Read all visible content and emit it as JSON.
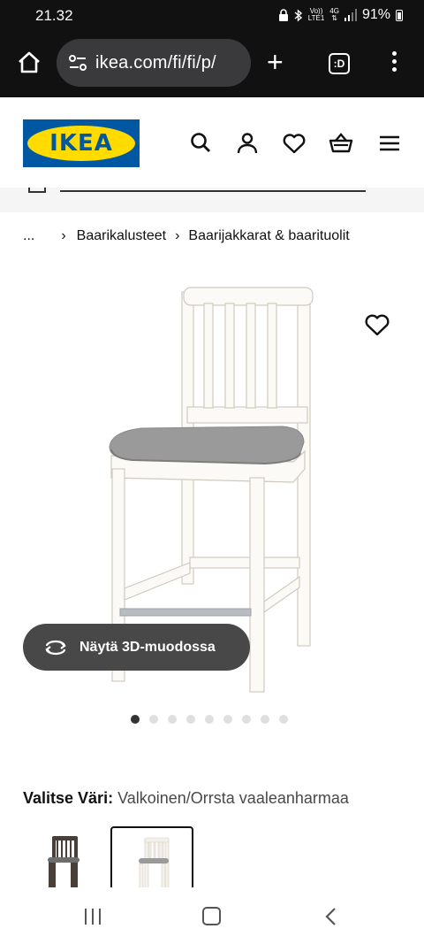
{
  "status_bar": {
    "time": "21.32",
    "network_top": "Vo))",
    "network_bottom": "LTE1",
    "network_type": "4G",
    "battery": "91%"
  },
  "browser": {
    "url": "ikea.com/fi/fi/p/",
    "tab_count": ":D",
    "icons": [
      "home-icon",
      "site-settings-icon",
      "new-tab-icon",
      "tab-switcher-icon",
      "menu-icon"
    ]
  },
  "header": {
    "logo_text": "IKEA",
    "icons": [
      "search-icon",
      "account-icon",
      "favourites-icon",
      "shopping-bag-icon",
      "hamburger-menu-icon"
    ]
  },
  "breadcrumb": {
    "ellipsis": "...",
    "items": [
      "Baarikalusteet",
      "Baarijakkarat & baarituolit"
    ]
  },
  "product": {
    "view_3d_label": "Näytä 3D-muodossa",
    "carousel_total": 9,
    "carousel_active": 0
  },
  "color_select": {
    "label": "Valitse Väri:",
    "value": "Valkoinen/Orrsta vaaleanharmaa",
    "options": [
      {
        "name": "dark-brown-swatch",
        "selected": false
      },
      {
        "name": "white-swatch",
        "selected": true
      }
    ]
  },
  "colors": {
    "ikea_blue": "#0058a3",
    "ikea_yellow": "#ffdb00",
    "button_dark": "#484848",
    "system_bar": "#111111"
  }
}
